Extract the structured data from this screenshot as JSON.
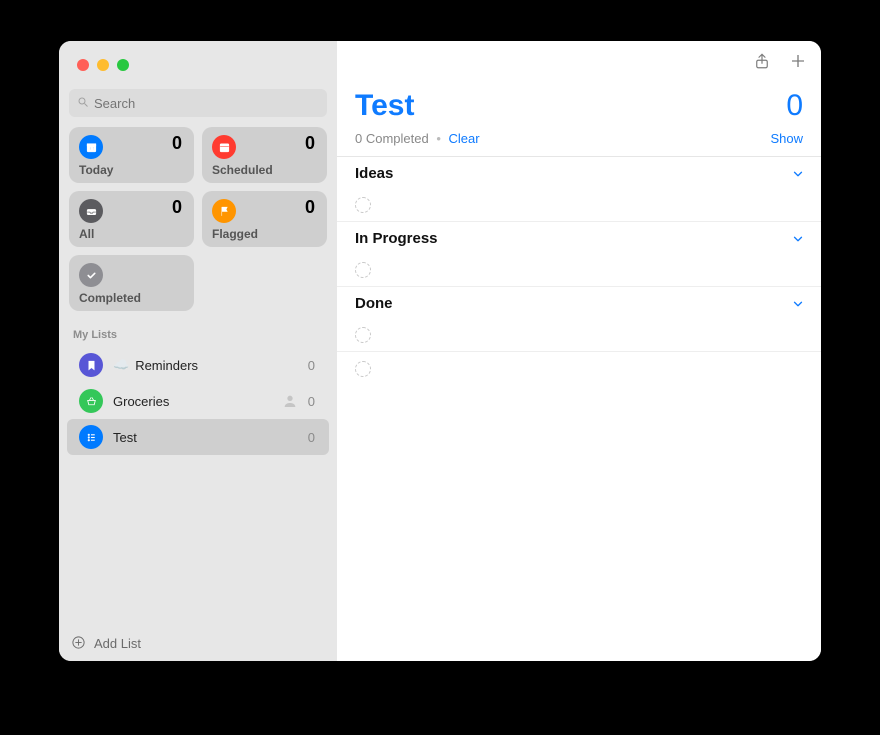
{
  "search": {
    "placeholder": "Search"
  },
  "smart": {
    "today": {
      "label": "Today",
      "count": "0"
    },
    "scheduled": {
      "label": "Scheduled",
      "count": "0"
    },
    "all": {
      "label": "All",
      "count": "0"
    },
    "flagged": {
      "label": "Flagged",
      "count": "0"
    },
    "completed": {
      "label": "Completed"
    }
  },
  "mylists_header": "My Lists",
  "lists": [
    {
      "name": "Reminders",
      "emoji": "☁️",
      "count": "0"
    },
    {
      "name": "Groceries",
      "count": "0",
      "shared": true
    },
    {
      "name": "Test",
      "count": "0",
      "selected": true
    }
  ],
  "addlist_label": "Add List",
  "main": {
    "title": "Test",
    "count": "0",
    "completed_text": "0 Completed",
    "clear_label": "Clear",
    "show_label": "Show",
    "sections": [
      {
        "title": "Ideas"
      },
      {
        "title": "In Progress"
      },
      {
        "title": "Done"
      }
    ]
  }
}
